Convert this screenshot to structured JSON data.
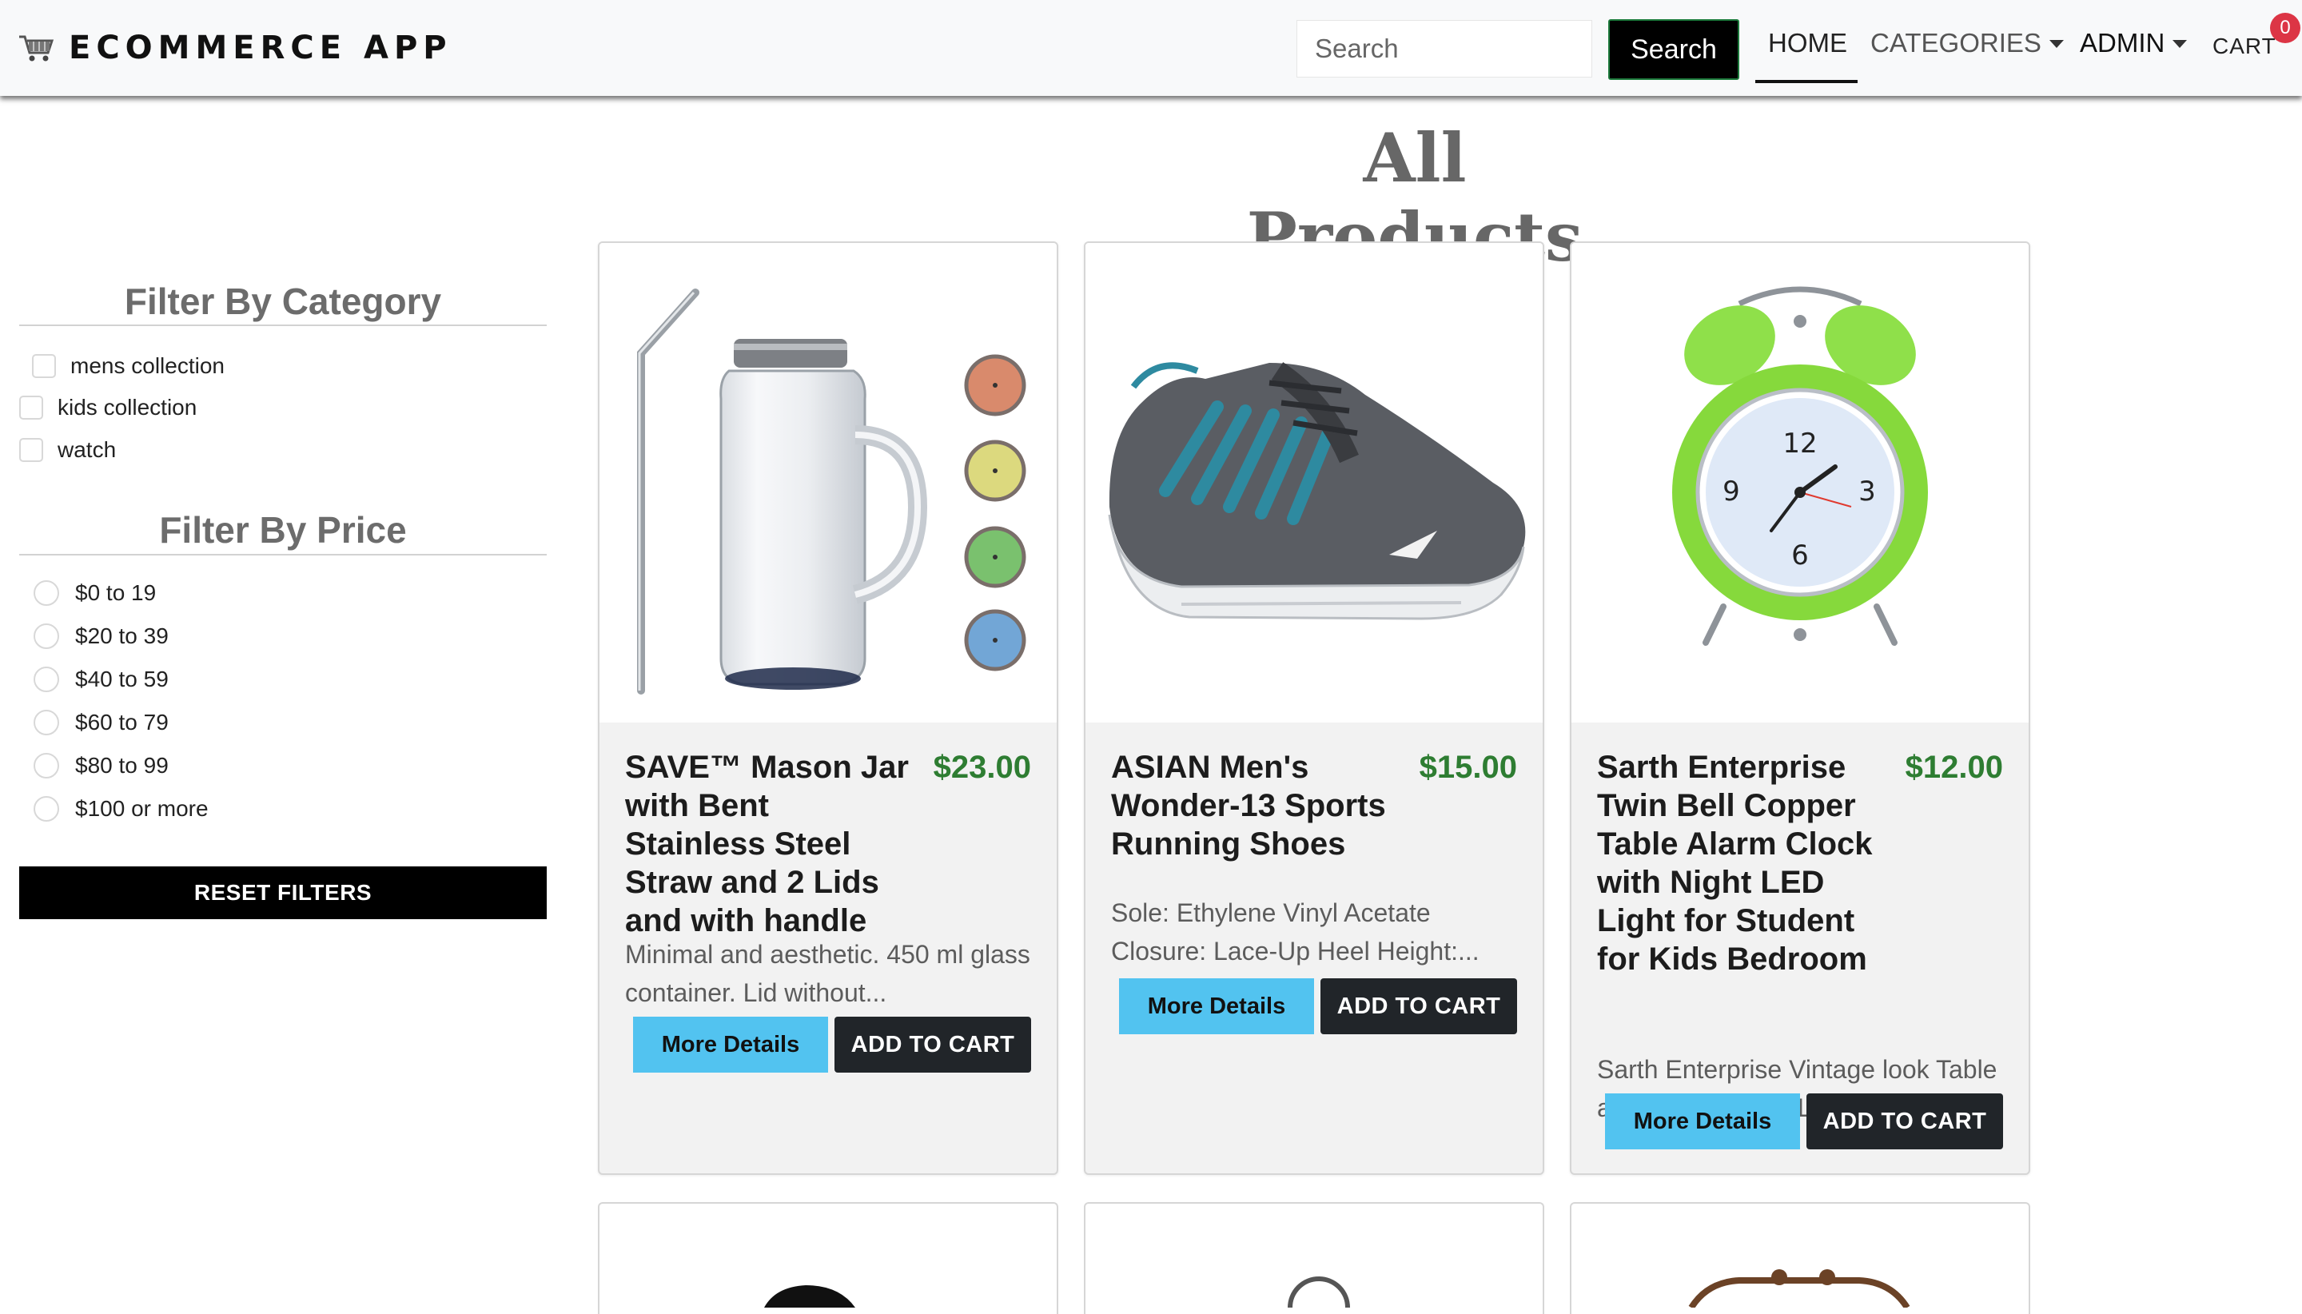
{
  "navbar": {
    "brand": "ECOMMERCE APP",
    "brand_icon": "shopping-cart-icon",
    "search_placeholder": "Search",
    "search_button": "Search",
    "links": {
      "home": "HOME",
      "categories": "CATEGORIES",
      "admin": "ADMIN",
      "cart": "CART"
    },
    "cart_count": "0"
  },
  "page_title": "All Products",
  "filters": {
    "category_heading": "Filter By Category",
    "categories": [
      "mens collection",
      "kids collection",
      "watch"
    ],
    "price_heading": "Filter By Price",
    "prices": [
      "$0 to 19",
      "$20 to 39",
      "$40 to 59",
      "$60 to 79",
      "$80 to 99",
      "$100 or more"
    ],
    "reset_label": "RESET FILTERS"
  },
  "products": [
    {
      "name": "SAVE™ Mason Jar with Bent Stainless Steel Straw and 2 Lids and with handle",
      "price": "$23.00",
      "description": "Minimal and aesthetic. 450 ml glass container. Lid without...",
      "image": "mason-jar-image",
      "more_label": "More Details",
      "cart_label": "ADD TO CART"
    },
    {
      "name": "ASIAN Men's Wonder-13 Sports Running Shoes",
      "price": "$15.00",
      "description": "Sole: Ethylene Vinyl Acetate Closure: Lace-Up Heel Height:...",
      "image": "sports-shoe-image",
      "more_label": "More Details",
      "cart_label": "ADD TO CART"
    },
    {
      "name": "Sarth Enterprise Twin Bell Copper Table Alarm Clock with Night LED Light for Student for Kids Bedroom",
      "price": "$12.00",
      "description": "Sarth Enterprise Vintage look Table alarm Clock With Led Lig...",
      "image": "alarm-clock-image",
      "more_label": "More Details",
      "cart_label": "ADD TO CART"
    }
  ],
  "colors": {
    "price": "#2e7d32",
    "more_button": "#52c3f0",
    "cart_button": "#212529",
    "badge": "#dc3545"
  }
}
